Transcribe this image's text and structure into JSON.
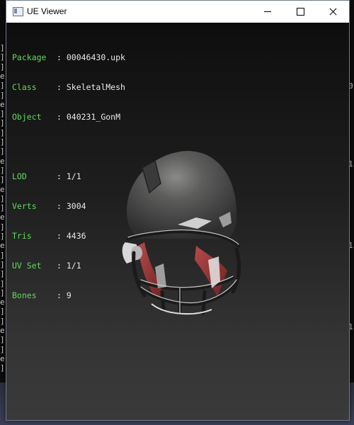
{
  "window": {
    "title": "UE Viewer"
  },
  "info": {
    "package": {
      "label": "Package",
      "value": "00046430.upk"
    },
    "class": {
      "label": "Class  ",
      "value": "SkeletalMesh"
    },
    "object": {
      "label": "Object ",
      "value": "040231_GonM"
    },
    "lod": {
      "label": "LOD    ",
      "value": "1/1"
    },
    "verts": {
      "label": "Verts  ",
      "value": "3004"
    },
    "tris": {
      "label": "Tris   ",
      "value": "4436"
    },
    "uvset": {
      "label": "UV Set ",
      "value": "1/1"
    },
    "bones": {
      "label": "Bones  ",
      "value": "9"
    }
  },
  "background": {
    "left_glyphs": [
      "]",
      "]",
      "]",
      "e",
      "]",
      "]",
      "e",
      "]",
      "]",
      "]",
      "]",
      "]",
      "e",
      "]",
      "]",
      "e",
      "]",
      "]",
      "e",
      "]",
      "]",
      "e",
      "]",
      "]",
      "]",
      "]",
      "]",
      "e",
      "]",
      "]",
      "e",
      "]",
      "]",
      "e",
      "]"
    ],
    "right_glyphs": [
      "0",
      "1",
      "1",
      "1"
    ]
  },
  "colors": {
    "label": "#5ddb5d",
    "value": "#e8e8e8",
    "titlebar": "#ffffff"
  }
}
